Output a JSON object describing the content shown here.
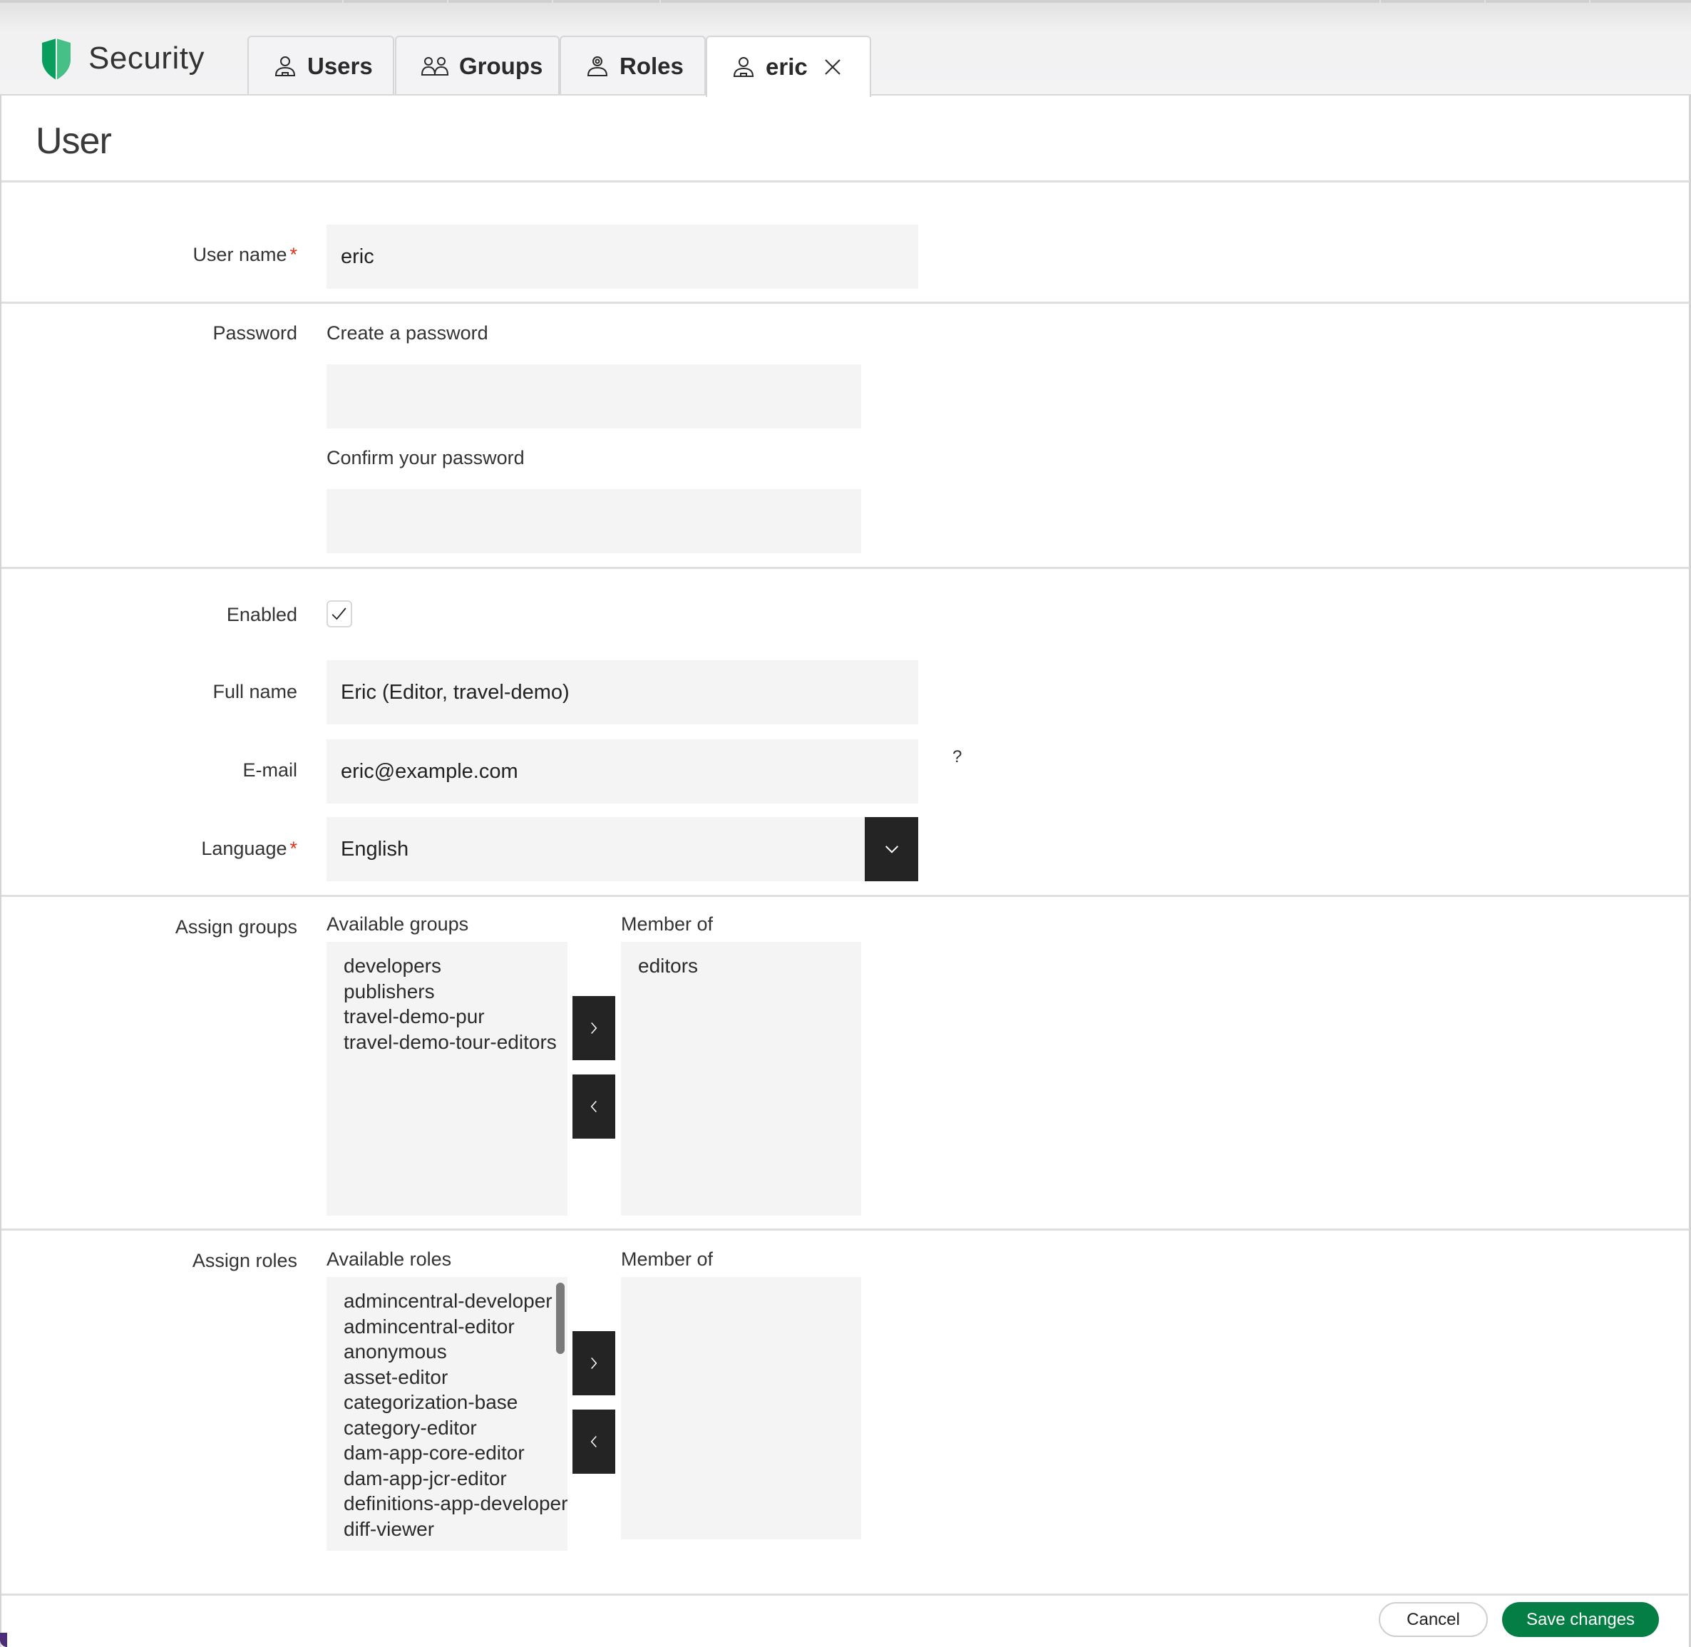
{
  "app": {
    "title": "Security",
    "brand_color": "#0a9e5e",
    "brand_color_light": "#47c088"
  },
  "tabs": [
    {
      "label": "Users",
      "icon": "user-icon",
      "active": false,
      "closable": false
    },
    {
      "label": "Groups",
      "icon": "group-icon",
      "active": false,
      "closable": false
    },
    {
      "label": "Roles",
      "icon": "role-icon",
      "active": false,
      "closable": false
    },
    {
      "label": "eric",
      "icon": "user-icon",
      "active": true,
      "closable": true
    }
  ],
  "page": {
    "title": "User"
  },
  "form": {
    "username": {
      "label": "User name",
      "required": true,
      "value": "eric"
    },
    "password": {
      "label": "Password",
      "create_label": "Create a password",
      "create_value": "",
      "confirm_label": "Confirm your password",
      "confirm_value": ""
    },
    "enabled": {
      "label": "Enabled",
      "checked": true
    },
    "fullname": {
      "label": "Full name",
      "value": "Eric (Editor, travel-demo)"
    },
    "email": {
      "label": "E-mail",
      "value": "eric@example.com",
      "help": "?"
    },
    "language": {
      "label": "Language",
      "required": true,
      "value": "English"
    },
    "groups": {
      "label": "Assign groups",
      "available_label": "Available groups",
      "member_label": "Member of",
      "available": [
        "developers",
        "publishers",
        "travel-demo-pur",
        "travel-demo-tour-editors"
      ],
      "member": [
        "editors"
      ]
    },
    "roles": {
      "label": "Assign roles",
      "available_label": "Available roles",
      "member_label": "Member of",
      "available": [
        "admincentral-developer",
        "admincentral-editor",
        "anonymous",
        "asset-editor",
        "categorization-base",
        "category-editor",
        "dam-app-core-editor",
        "dam-app-jcr-editor",
        "definitions-app-developer",
        "diff-viewer"
      ],
      "member": []
    },
    "required_marker": "*"
  },
  "footer": {
    "cancel_label": "Cancel",
    "save_label": "Save changes",
    "save_color": "#047e44"
  }
}
